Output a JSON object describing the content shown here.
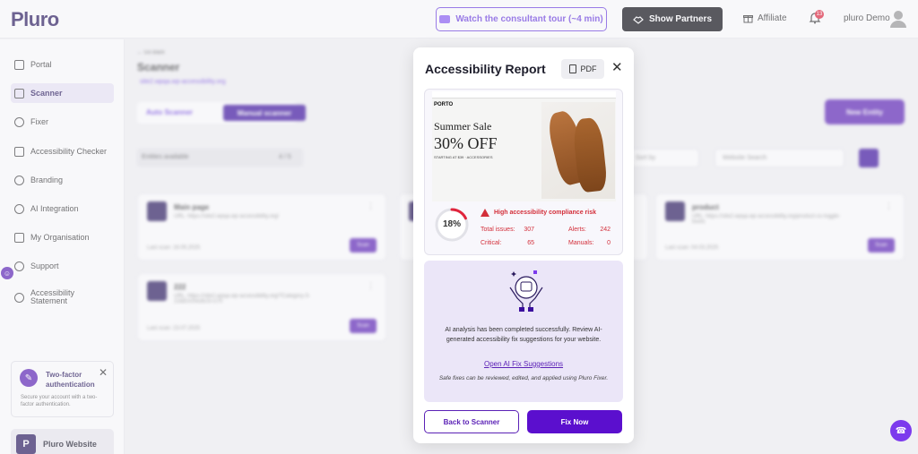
{
  "header": {
    "logo": "Pluro",
    "tour_label": "Watch the consultant tour (~4 min)",
    "partners_label": "Show Partners",
    "affiliate_label": "Affiliate",
    "notification_count": "13",
    "user_name": "pluro Demo"
  },
  "sidebar": {
    "items": [
      {
        "label": "Portal"
      },
      {
        "label": "Scanner"
      },
      {
        "label": "Fixer"
      },
      {
        "label": "Accessibility Checker"
      },
      {
        "label": "Branding"
      },
      {
        "label": "AI Integration"
      },
      {
        "label": "My Organisation"
      },
      {
        "label": "Support"
      },
      {
        "label": "Accessibility Statement"
      }
    ],
    "tfa": {
      "title": "Two-factor authentication",
      "description": "Secure your account with a two-factor authentication."
    },
    "website_label": "Pluro Website",
    "website_icon": "P"
  },
  "background": {
    "back": "← Go Back",
    "title": "Scanner",
    "domain": "site2.wpqa.wp-accessibility.org",
    "tab_auto": "Auto Scanner",
    "tab_manual": "Manual scanner",
    "entities": "Entities available",
    "entities_count": "4 / 5",
    "new_entity": "New Entity",
    "sort_placeholder": "Sort by",
    "search_placeholder": "Website Search",
    "cards": [
      {
        "name": "Main page",
        "url": "URL: https://site2.wpqa.wp-accessibility.org/",
        "last": "Last scan: 16.05.2025",
        "scan": "Scan"
      },
      {
        "name": "product",
        "url": "URL: https://site2.wpqa.wp-accessibility.org/product-ss-toggle-boots",
        "last": "Last scan: 04.03.2025",
        "scan": "Scan"
      },
      {
        "name": "222",
        "url": "URL: https://site2.wpqa.wp-accessibility.org/?Category-3-22&EmS4o6cS=170",
        "last": "Last scan: 23.07.2025",
        "scan": "Scan"
      }
    ]
  },
  "modal": {
    "title": "Accessibility Report",
    "pdf_label": "PDF",
    "screenshot": {
      "logo": "PORTO",
      "headline": "Summer Sale",
      "offer": "30% OFF",
      "small": "STARTING AT $39 · ACCESSORIES"
    },
    "score": "18%",
    "score_value": 0.18,
    "risk_label": "High accessibility compliance risk",
    "stats": {
      "total_issues_label": "Total issues:",
      "total_issues": "307",
      "alerts_label": "Alerts:",
      "alerts": "242",
      "critical_label": "Critical:",
      "critical": "65",
      "manuals_label": "Manuals:",
      "manuals": "0"
    },
    "ai_text": "AI analysis has been completed successfully. Review AI-generated accessibility fix suggestions for your website.",
    "ai_link": "Open AI Fix Suggestions",
    "ai_note": "Safe fixes can be reviewed, edited, and applied using Pluro Fixer.",
    "back_label": "Back to Scanner",
    "fix_label": "Fix Now"
  },
  "colors": {
    "brand": "#5b21b6",
    "risk": "#d32f3a"
  }
}
